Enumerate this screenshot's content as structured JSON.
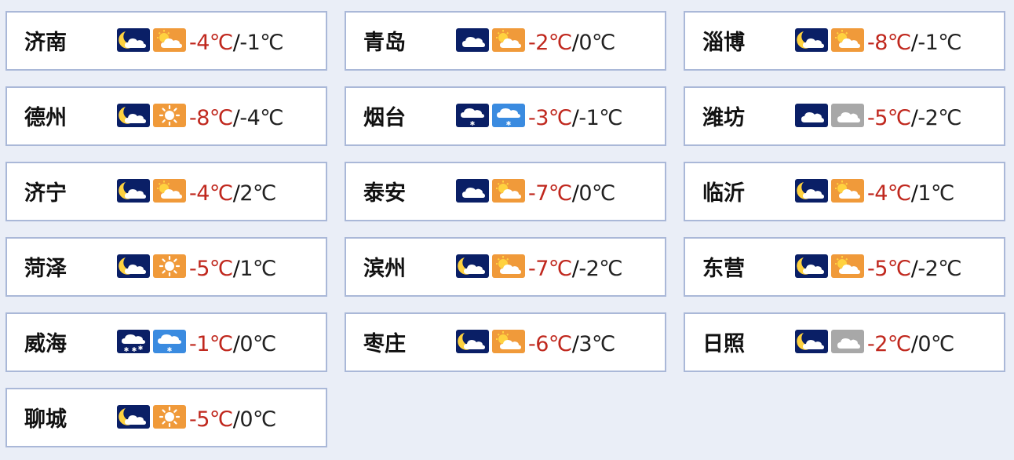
{
  "colors": {
    "background": "#eaeef7",
    "card_border": "#aab8d8",
    "low_temp": "#c0281e",
    "night_icon_bg": "#0a1f66",
    "sunny_icon_bg": "#f09a3a",
    "snow_icon_bg": "#3a8be0",
    "cloudy_icon_bg": "#a8a8a8"
  },
  "cities": [
    {
      "name": "济南",
      "night_icon": "night-partly-cloudy-icon",
      "day_icon": "day-partly-cloudy-icon",
      "low": "-4℃",
      "sep": "/",
      "high": "-1℃"
    },
    {
      "name": "青岛",
      "night_icon": "night-cloudy-icon",
      "day_icon": "day-partly-cloudy-icon",
      "low": "-2℃",
      "sep": "/",
      "high": "0℃"
    },
    {
      "name": "淄博",
      "night_icon": "night-partly-cloudy-icon",
      "day_icon": "day-partly-cloudy-icon",
      "low": "-8℃",
      "sep": "/",
      "high": "-1℃"
    },
    {
      "name": "德州",
      "night_icon": "night-partly-cloudy-icon",
      "day_icon": "sunny-icon",
      "low": "-8℃",
      "sep": "/",
      "high": "-4℃"
    },
    {
      "name": "烟台",
      "night_icon": "night-snow-icon",
      "day_icon": "day-snow-icon",
      "low": "-3℃",
      "sep": "/",
      "high": "-1℃"
    },
    {
      "name": "潍坊",
      "night_icon": "night-cloudy-icon",
      "day_icon": "overcast-icon",
      "low": "-5℃",
      "sep": "/",
      "high": "-2℃"
    },
    {
      "name": "济宁",
      "night_icon": "night-partly-cloudy-icon",
      "day_icon": "day-partly-cloudy-icon",
      "low": "-4℃",
      "sep": "/",
      "high": "2℃"
    },
    {
      "name": "泰安",
      "night_icon": "night-cloudy-icon",
      "day_icon": "day-partly-cloudy-icon",
      "low": "-7℃",
      "sep": "/",
      "high": "0℃"
    },
    {
      "name": "临沂",
      "night_icon": "night-partly-cloudy-icon",
      "day_icon": "day-partly-cloudy-icon",
      "low": "-4℃",
      "sep": "/",
      "high": "1℃"
    },
    {
      "name": "菏泽",
      "night_icon": "night-partly-cloudy-icon",
      "day_icon": "sunny-icon",
      "low": "-5℃",
      "sep": "/",
      "high": "1℃"
    },
    {
      "name": "滨州",
      "night_icon": "night-partly-cloudy-icon",
      "day_icon": "day-partly-cloudy-icon",
      "low": "-7℃",
      "sep": "/",
      "high": "-2℃"
    },
    {
      "name": "东营",
      "night_icon": "night-partly-cloudy-icon",
      "day_icon": "day-partly-cloudy-icon",
      "low": "-5℃",
      "sep": "/",
      "high": "-2℃"
    },
    {
      "name": "威海",
      "night_icon": "night-snow-showers-icon",
      "day_icon": "day-snow-icon",
      "low": "-1℃",
      "sep": "/",
      "high": "0℃"
    },
    {
      "name": "枣庄",
      "night_icon": "night-partly-cloudy-icon",
      "day_icon": "day-partly-cloudy-icon",
      "low": "-6℃",
      "sep": "/",
      "high": "3℃"
    },
    {
      "name": "日照",
      "night_icon": "night-partly-cloudy-icon",
      "day_icon": "overcast-icon",
      "low": "-2℃",
      "sep": "/",
      "high": "0℃"
    },
    {
      "name": "聊城",
      "night_icon": "night-partly-cloudy-icon",
      "day_icon": "sunny-icon",
      "low": "-5℃",
      "sep": "/",
      "high": "0℃"
    }
  ]
}
